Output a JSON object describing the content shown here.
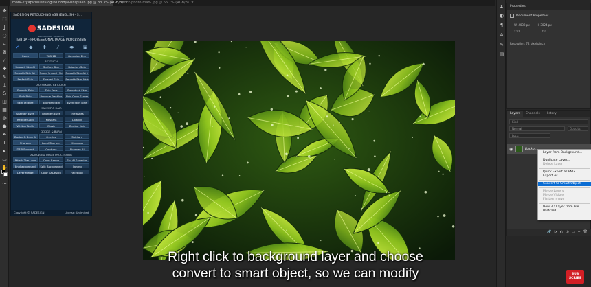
{
  "tabs": [
    {
      "label": "mark-kryapichnikov-og190n8djal-unsplash.jpg @ 33.3% (RGB/8)"
    },
    {
      "label": "stock-photo-man-.jpg @ 66.7% (RGB/8)"
    }
  ],
  "toolbar": {
    "tools": [
      "move-tool",
      "marquee-tool",
      "lasso-tool",
      "quick-select-tool",
      "crop-tool",
      "frame-tool",
      "eyedropper-tool",
      "healing-tool",
      "brush-tool",
      "stamp-tool",
      "history-brush-tool",
      "eraser-tool",
      "gradient-tool",
      "blur-tool",
      "dodge-tool",
      "pen-tool",
      "type-tool",
      "path-select-tool",
      "shape-tool",
      "hand-tool",
      "zoom-tool",
      "more-tools"
    ],
    "glyphs": [
      "✥",
      "⬚",
      "ʆ",
      "◌",
      "⌗",
      "⊠",
      "⁄",
      "✚",
      "✎",
      "⊥",
      "♺",
      "◫",
      "▦",
      "◍",
      "●",
      "✒",
      "T",
      "▸",
      "▭",
      "✋",
      "⌕",
      "···"
    ]
  },
  "sadesign": {
    "title": "SADESIGN RETOUCHING V3S (ENGLISH - S...",
    "logo_text": "SADESIGN",
    "logo_sub": "RETOUCHING · ACADEMY",
    "tab_heading": "TAB 1A - PROFESSIONAL IMAGE PROCESSING",
    "icons": [
      {
        "name": "check-icon",
        "glyph": "✔"
      },
      {
        "name": "droplet-icon",
        "glyph": "◆"
      },
      {
        "name": "bandage-icon",
        "glyph": "✚"
      },
      {
        "name": "pipette-icon",
        "glyph": "⁄"
      },
      {
        "name": "pill-icon",
        "glyph": "⬬"
      },
      {
        "name": "bucket-icon",
        "glyph": "▣"
      }
    ],
    "top_row": [
      "Open",
      "TAB 1B",
      "Gaussian Blur"
    ],
    "sections": [
      {
        "title": "RETOUCH",
        "rows": [
          [
            "Smooth Skin AI",
            "Surface Blur",
            "Brighten Skin"
          ],
          [
            "Smooth Skin A+",
            "Super Smooth Skin",
            "Smooth Skin A++"
          ],
          [
            "Perfect Skin",
            "Frosted Skin",
            "Smooth Skin A+++"
          ]
        ]
      },
      {
        "title": "AUTOMATIC RETOUCH",
        "rows": [
          [
            "Smooth Skin",
            "Skin Face",
            "Smooth + Skin"
          ],
          [
            "Bulk Skin",
            "Remove Freckles",
            "Skin Color Scales"
          ],
          [
            "Skin Texture",
            "Brighten Skin",
            "Even Skin Tone"
          ]
        ]
      },
      {
        "title": "MAKEUP & HAIR",
        "rows": [
          [
            "Sharpen Eyes",
            "Brighten Eyes",
            "Eyelashes"
          ],
          [
            "Reduce Gold",
            "Mascara",
            "Lipstick"
          ],
          [
            "Whiten Teeth",
            "Blush",
            "Dyeing Hair"
          ]
        ]
      },
      {
        "title": "DODGE & BURN",
        "rows": [
          [
            "Dodge & Burn AI",
            "Overlay",
            "Softlight"
          ],
          [
            "Sharpen",
            "Local Sharpen",
            "Highpass"
          ],
          [
            "D&B Support",
            "Contrast",
            "Sharpen AI"
          ]
        ]
      },
      {
        "title": "ADVANCED IMAGE PROCESSING",
        "rows": [
          [
            "Attach The Logo",
            "Color Range",
            "Sky AI Sadesign"
          ],
          [
            "Enhbackground",
            "Split Background",
            "Ironing"
          ],
          [
            "Layer Merge",
            "Color SaDesign",
            "Facebook"
          ]
        ]
      }
    ],
    "footer_left": "Copyright © SADESIGN",
    "footer_right": "License: Unlimited"
  },
  "properties": {
    "header": "Properties",
    "kind": "Document Properties",
    "w": "W:  4032 px",
    "h": "H:  3024 px",
    "x": "X:  0",
    "y": "Y:  0",
    "resolution": "Resolution: 72 pixels/inch"
  },
  "layers": {
    "tabs": [
      "Layers",
      "Channels",
      "History"
    ],
    "kind_filter": "Kind",
    "blend_mode": "Normal",
    "opacity": "Opacity:",
    "lock": "Lock:",
    "layer_name": "Backg...",
    "bottom_icons": [
      "🔗",
      "fx",
      "◐",
      "◑",
      "▭",
      "+",
      "🗑"
    ]
  },
  "context_menu": {
    "groups": [
      [
        {
          "label": "Layer from Background...",
          "state": "normal"
        }
      ],
      [
        {
          "label": "Duplicate Layer...",
          "state": "normal"
        },
        {
          "label": "Delete Layer",
          "state": "disabled"
        }
      ],
      [
        {
          "label": "Quick Export as PNG",
          "state": "normal"
        },
        {
          "label": "Export As...",
          "state": "normal"
        }
      ],
      [
        {
          "label": "Convert to Smart Object",
          "state": "highlighted"
        }
      ],
      [
        {
          "label": "Merge Layers",
          "state": "disabled"
        },
        {
          "label": "Merge Visible",
          "state": "disabled"
        },
        {
          "label": "Flatten Image",
          "state": "disabled"
        }
      ],
      [
        {
          "label": "New 3D Layer from File...",
          "state": "normal"
        },
        {
          "label": "Postcard",
          "state": "normal"
        }
      ]
    ]
  },
  "subtitle": {
    "line1": "Right click to background layer and choose",
    "line2": "convert to smart object, so we can modify"
  },
  "subscribe_label": "SUB SCRIBE"
}
